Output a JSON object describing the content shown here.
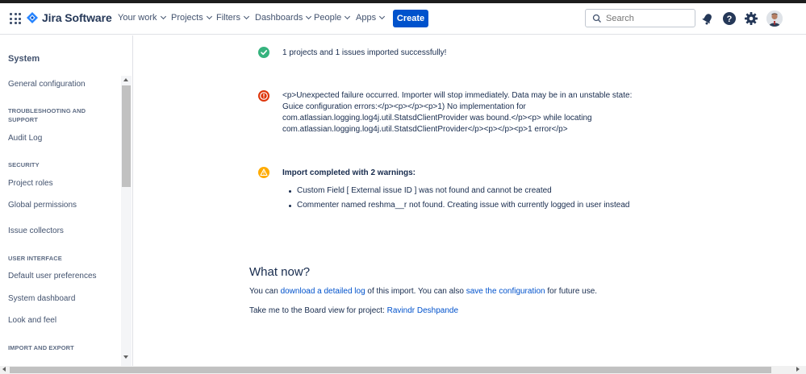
{
  "header": {
    "brand": "Jira Software",
    "nav": [
      "Your work",
      "Projects",
      "Filters",
      "Dashboards",
      "People",
      "Apps"
    ],
    "create_label": "Create",
    "search_placeholder": "Search"
  },
  "sidebar": {
    "title": "System",
    "general_configuration": "General configuration",
    "troubleshooting_heading": "TROUBLESHOOTING AND SUPPORT",
    "audit_log": "Audit Log",
    "security_heading": "SECURITY",
    "project_roles": "Project roles",
    "global_permissions": "Global permissions",
    "issue_collectors": "Issue collectors",
    "user_interface_heading": "USER INTERFACE",
    "default_user_preferences": "Default user preferences",
    "system_dashboard": "System dashboard",
    "look_and_feel": "Look and feel",
    "import_export_heading": "IMPORT AND EXPORT"
  },
  "messages": {
    "success": "1 projects and 1 issues imported successfully!",
    "error": "<p>Unexpected failure occurred. Importer will stop immediately. Data may be in an unstable state: Guice configuration errors:</p><p></p><p>1) No implementation for com.atlassian.logging.log4j.util.StatsdClientProvider was bound.</p><p> while locating com.atlassian.logging.log4j.util.StatsdClientProvider</p><p></p><p>1 error</p>",
    "warning_title": "Import completed with 2 warnings:",
    "warnings": [
      "Custom Field [ External issue ID ] was not found and cannot be created",
      "Commenter named reshma__r not found. Creating issue with currently logged in user instead"
    ]
  },
  "what_now": {
    "heading": "What now?",
    "line1_prefix": "You can ",
    "line1_link1": "download a detailed log",
    "line1_middle": " of this import. You can also ",
    "line1_link2": "save the configuration",
    "line1_suffix": " for future use.",
    "line2_prefix": "Take me to the Board view for project: ",
    "line2_link": "Ravindr Deshpande"
  },
  "colors": {
    "primary": "#0052cc",
    "success": "#36b37e",
    "error": "#de350b",
    "warning": "#ffab00",
    "text": "#172b4d"
  },
  "icons": [
    "app-switcher-icon",
    "jira-logo-icon",
    "search-icon",
    "notifications-icon",
    "help-icon",
    "settings-icon",
    "success-icon",
    "error-icon",
    "warning-icon"
  ]
}
